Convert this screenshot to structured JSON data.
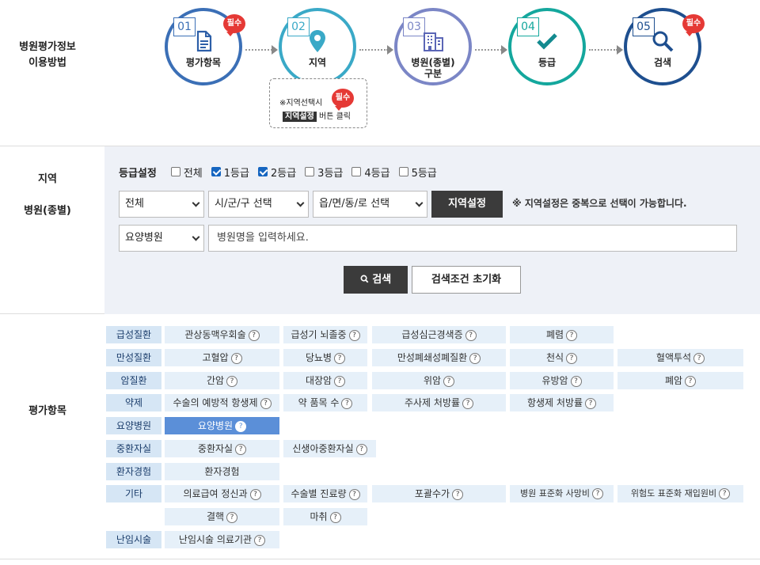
{
  "steps_label": [
    "병원평가정보",
    "이용방법"
  ],
  "steps": [
    {
      "num": "01",
      "label": "평가항목",
      "label2": "",
      "required": "필수",
      "icon": "document-icon"
    },
    {
      "num": "02",
      "label": "지역",
      "label2": "",
      "required": "",
      "icon": "location-pin-icon"
    },
    {
      "num": "03",
      "label": "병원(종별)",
      "label2": "구분",
      "required": "",
      "icon": "building-icon"
    },
    {
      "num": "04",
      "label": "등급",
      "label2": "",
      "required": "",
      "icon": "check-icon"
    },
    {
      "num": "05",
      "label": "검색",
      "label2": "",
      "required": "필수",
      "icon": "search-icon"
    }
  ],
  "note": {
    "line1": "※지역선택시",
    "tag": "지역설정",
    "line2": "버튼 클릭",
    "required": "필수"
  },
  "search": {
    "label1": "지역",
    "label2": "병원(종별)",
    "grade_label": "등급설정",
    "grades": [
      {
        "label": "전체",
        "checked": false
      },
      {
        "label": "1등급",
        "checked": true
      },
      {
        "label": "2등급",
        "checked": true
      },
      {
        "label": "3등급",
        "checked": false
      },
      {
        "label": "4등급",
        "checked": false
      },
      {
        "label": "5등급",
        "checked": false
      }
    ],
    "sido": "전체",
    "sigungu": "시/군/구 선택",
    "dong": "읍/면/동/로 선택",
    "region_button": "지역설정",
    "region_hint": "※ 지역설정은 중복으로 선택이 가능합니다.",
    "type_select": "요양병원",
    "name_placeholder": "병원명을 입력하세요.",
    "search_button": "검색",
    "reset_button": "검색조건 초기화"
  },
  "items_label": "평가항목",
  "categories": [
    {
      "name": "급성질환",
      "items": [
        "관상동맥우회술",
        "급성기 뇌졸중",
        "급성심근경색증",
        "폐렴"
      ]
    },
    {
      "name": "만성질환",
      "items": [
        "고혈압",
        "당뇨병",
        "만성폐쇄성폐질환",
        "천식",
        "혈액투석"
      ]
    },
    {
      "name": "암질환",
      "items": [
        "간암",
        "대장암",
        "위암",
        "유방암",
        "폐암"
      ]
    },
    {
      "name": "약제",
      "items": [
        "수술의 예방적 항생제",
        "약 품목 수",
        "주사제 처방률",
        "항생제 처방률"
      ]
    },
    {
      "name": "요양병원",
      "items": [
        "요양병원"
      ]
    },
    {
      "name": "중환자실",
      "items": [
        "중환자실",
        "신생아중환자실"
      ]
    },
    {
      "name": "환자경험",
      "items": [
        "환자경험"
      ]
    },
    {
      "name": "기타",
      "items": [
        "의료급여 정신과",
        "수술별 진료량",
        "포괄수가",
        "병원 표준화 사망비",
        "위험도 표준화 재입원비",
        "결핵",
        "마취"
      ]
    },
    {
      "name": "난임시술",
      "items": [
        "난임시술 의료기관"
      ]
    }
  ],
  "help_glyph": "?",
  "colors": {
    "step1": "#3b6fb6",
    "step2": "#3aa9c7",
    "step3": "#7b86c6",
    "step4": "#14a79d",
    "step5": "#1e4f8f",
    "required": "#e53935",
    "selected": "#5b8fd8"
  }
}
